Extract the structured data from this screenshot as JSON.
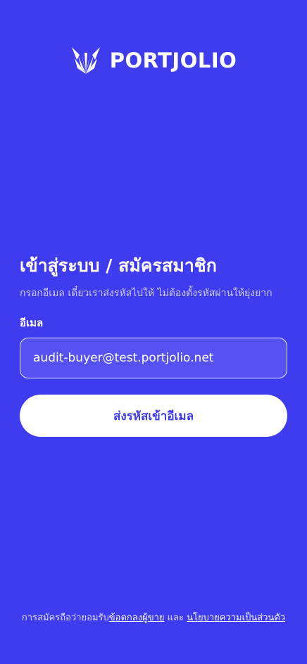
{
  "brand": {
    "name": "PORTJOLIO",
    "logo_icon": "fox-logo-icon"
  },
  "auth": {
    "title": "เข้าสู่ระบบ / สมัครสมาชิก",
    "subtitle": "กรอกอีเมล เดี๋ยวเราส่งรหัสไปให้ ไม่ต้องตั้งรหัสผ่านให้ยุ่งยาก",
    "email_label": "อีเมล",
    "email_value": "audit-buyer@test.portjolio.net",
    "submit_label": "ส่งรหัสเข้าอีเมล"
  },
  "footer": {
    "prefix": "การสมัครถือว่ายอมรับ",
    "terms_link": "ข้อตกลงผู้ขาย",
    "conjunction": " และ ",
    "privacy_link": "นโยบายความเป็นส่วนตัว"
  },
  "colors": {
    "background": "#3F3BEF",
    "button_bg": "#FFFFFF",
    "button_text": "#3F3BEF",
    "text": "#FFFFFF"
  }
}
